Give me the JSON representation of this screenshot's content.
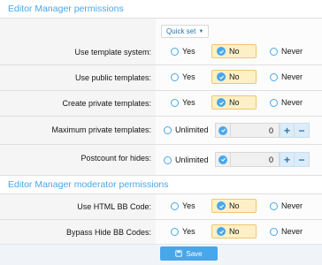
{
  "sections": [
    {
      "title": "Editor Manager permissions",
      "quick_set_label": "Quick set"
    },
    {
      "title": "Editor Manager moderator permissions"
    }
  ],
  "options": {
    "yes": "Yes",
    "no": "No",
    "never": "Never",
    "unlimited": "Unlimited"
  },
  "rows": [
    {
      "label": "Use template system:",
      "selected": "No"
    },
    {
      "label": "Use public templates:",
      "selected": "No"
    },
    {
      "label": "Create private templates:",
      "selected": "No"
    },
    {
      "label": "Maximum private templates:",
      "value": "0"
    },
    {
      "label": "Postcount for hides:",
      "value": "0"
    },
    {
      "label": "Use HTML BB Code:",
      "selected": "No"
    },
    {
      "label": "Bypass Hide BB Codes:",
      "selected": "No"
    }
  ],
  "footer": {
    "save_label": "Save"
  },
  "colors": {
    "accent": "#47a7eb",
    "selected_bg": "#fdf0c6"
  }
}
